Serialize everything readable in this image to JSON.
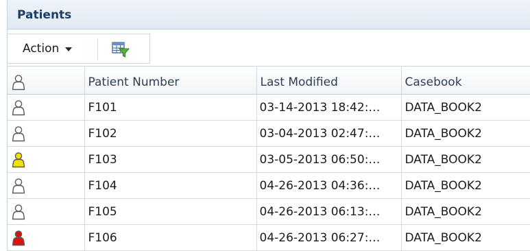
{
  "panel": {
    "title": "Patients"
  },
  "toolbar": {
    "action_label": "Action"
  },
  "columns": [
    "Patient Number",
    "Last Modified",
    "Casebook"
  ],
  "status_colors": {
    "default": "#ffffff",
    "yellow": "#f2e200",
    "red": "#e01010"
  },
  "rows": [
    {
      "status": "default",
      "patient": "F101",
      "modified": "03-14-2013 18:42:…",
      "casebook": "DATA_BOOK2"
    },
    {
      "status": "default",
      "patient": "F102",
      "modified": "03-04-2013 02:47:…",
      "casebook": "DATA_BOOK2"
    },
    {
      "status": "yellow",
      "patient": "F103",
      "modified": "03-05-2013 06:50:…",
      "casebook": "DATA_BOOK2"
    },
    {
      "status": "default",
      "patient": "F104",
      "modified": "04-26-2013 04:36:…",
      "casebook": "DATA_BOOK2"
    },
    {
      "status": "default",
      "patient": "F105",
      "modified": "04-26-2013 06:13:…",
      "casebook": "DATA_BOOK2"
    },
    {
      "status": "red",
      "patient": "F106",
      "modified": "04-26-2013 06:27:…",
      "casebook": "DATA_BOOK2"
    }
  ]
}
